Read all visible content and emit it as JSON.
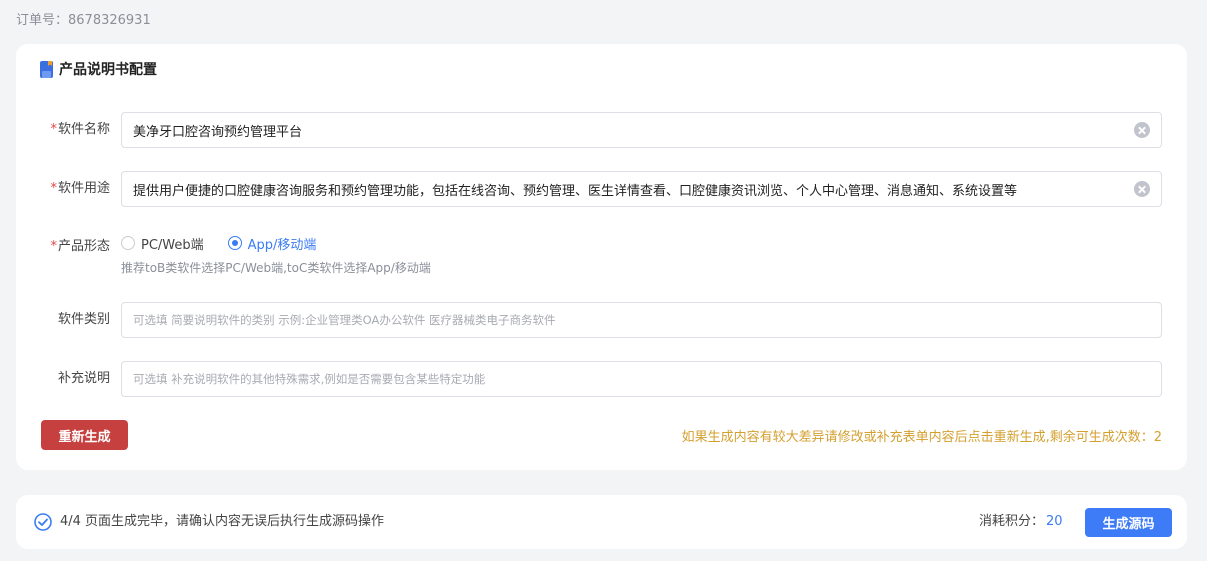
{
  "order": {
    "label": "订单号：",
    "number": "8678326931"
  },
  "card": {
    "title": "产品说明书配置",
    "fields": {
      "software_name": {
        "required": "*",
        "label": "软件名称",
        "value": "美净牙口腔咨询预约管理平台"
      },
      "software_usage": {
        "required": "*",
        "label": "软件用途",
        "value": "提供用户便捷的口腔健康咨询服务和预约管理功能，包括在线咨询、预约管理、医生详情查看、口腔健康资讯浏览、个人中心管理、消息通知、系统设置等"
      },
      "product_form": {
        "required": "*",
        "label": "产品形态",
        "options": [
          {
            "label": "PC/Web端",
            "checked": false
          },
          {
            "label": "App/移动端",
            "checked": true
          }
        ],
        "hint": "推荐toB类软件选择PC/Web端,toC类软件选择App/移动端"
      },
      "software_category": {
        "label": "软件类别",
        "placeholder": "可选填 简要说明软件的类别 示例:企业管理类OA办公软件 医疗器械类电子商务软件"
      },
      "supplement": {
        "label": "补充说明",
        "placeholder": "可选填 补充说明软件的其他特殊需求,例如是否需要包含某些特定功能"
      }
    },
    "regen_button": "重新生成",
    "regen_note": "如果生成内容有较大差异请修改或补充表单内容后点击重新生成,剩余可生成次数：2"
  },
  "footer": {
    "status": "4/4 页面生成完毕，请确认内容无误后执行生成源码操作",
    "points_label": "消耗积分：",
    "points_value": "20",
    "generate_button": "生成源码"
  },
  "colors": {
    "primary": "#3d7cf6",
    "danger_button": "#c5403e",
    "warning_text": "#d4a030",
    "required_mark": "#e54545"
  },
  "icons": [
    "document-icon",
    "clear-icon",
    "radio-icon",
    "check-circle-icon"
  ]
}
